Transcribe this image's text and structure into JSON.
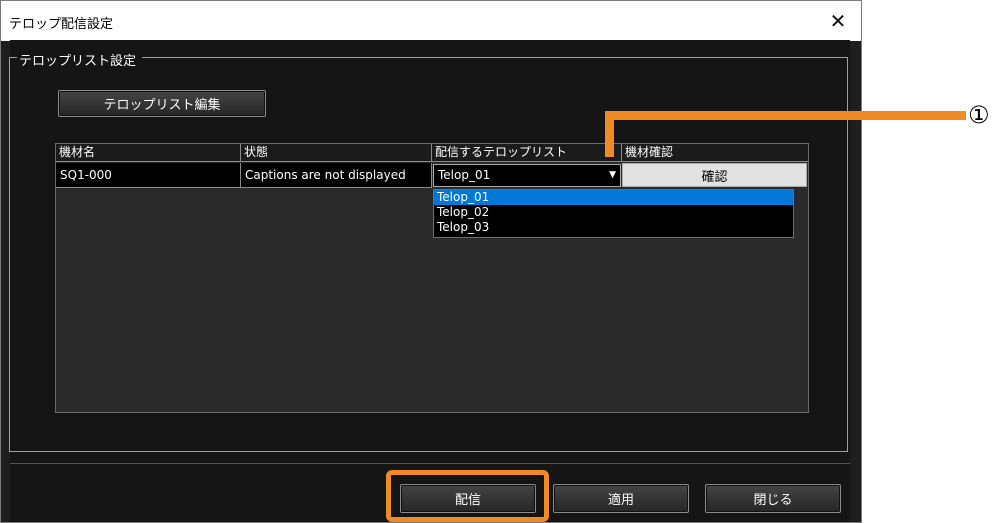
{
  "window": {
    "title": "テロップ配信設定",
    "close_glyph": "✕"
  },
  "group": {
    "legend": "テロップリスト設定",
    "edit_button": "テロップリスト編集"
  },
  "table": {
    "columns": [
      "機材名",
      "状態",
      "配信するテロップリスト",
      "機材確認"
    ],
    "rows": [
      {
        "device": "SQ1-000",
        "status": "Captions are not displayed",
        "telop_list": "Telop_01",
        "confirm": "確認"
      }
    ]
  },
  "dropdown": {
    "options": [
      "Telop_01",
      "Telop_02",
      "Telop_03"
    ],
    "selected": "Telop_01"
  },
  "buttons": {
    "deliver": "配信",
    "apply": "適用",
    "close": "閉じる"
  },
  "annotation": {
    "callout_label": "①",
    "accent_color": "#f08a24"
  },
  "icons": {
    "dropdown_arrow": "chevron-down-icon",
    "close": "close-icon"
  }
}
